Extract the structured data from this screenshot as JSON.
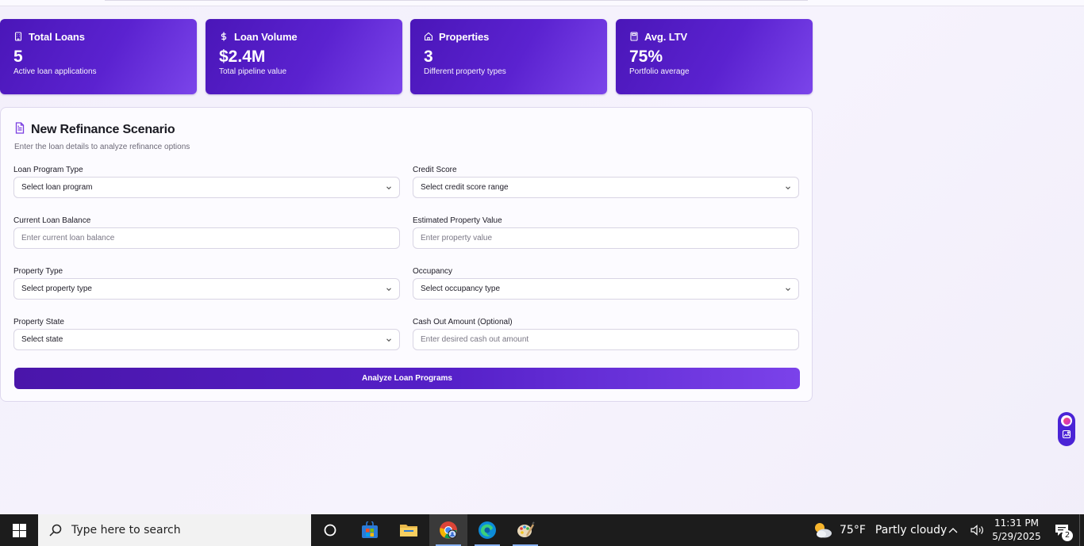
{
  "stats": [
    {
      "icon": "building-icon",
      "title": "Total Loans",
      "value": "5",
      "subtitle": "Active loan applications"
    },
    {
      "icon": "dollar-icon",
      "title": "Loan Volume",
      "value": "$2.4M",
      "subtitle": "Total pipeline value"
    },
    {
      "icon": "home-icon",
      "title": "Properties",
      "value": "3",
      "subtitle": "Different property types"
    },
    {
      "icon": "calculator-icon",
      "title": "Avg. LTV",
      "value": "75%",
      "subtitle": "Portfolio average"
    }
  ],
  "form": {
    "title": "New Refinance Scenario",
    "subtitle": "Enter the loan details to analyze refinance options",
    "fields": [
      {
        "label": "Loan Program Type",
        "kind": "select",
        "value": "Select loan program"
      },
      {
        "label": "Credit Score",
        "kind": "select",
        "value": "Select credit score range"
      },
      {
        "label": "Current Loan Balance",
        "kind": "input",
        "placeholder": "Enter current loan balance"
      },
      {
        "label": "Estimated Property Value",
        "kind": "input",
        "placeholder": "Enter property value"
      },
      {
        "label": "Property Type",
        "kind": "select",
        "value": "Select property type"
      },
      {
        "label": "Occupancy",
        "kind": "select",
        "value": "Select occupancy type"
      },
      {
        "label": "Property State",
        "kind": "select",
        "value": "Select state"
      },
      {
        "label": "Cash Out Amount (Optional)",
        "kind": "input",
        "placeholder": "Enter desired cash out amount"
      }
    ],
    "submit_label": "Analyze Loan Programs"
  },
  "colors": {
    "accent": "#5b22d0",
    "accent_light": "#7b45ea",
    "background": "#f4f1fc"
  },
  "taskbar": {
    "search_placeholder": "Type here to search",
    "weather_temp": "75°F",
    "weather_text": "Partly cloudy",
    "time": "11:31 PM",
    "date": "5/29/2025",
    "notification_count": "2"
  }
}
